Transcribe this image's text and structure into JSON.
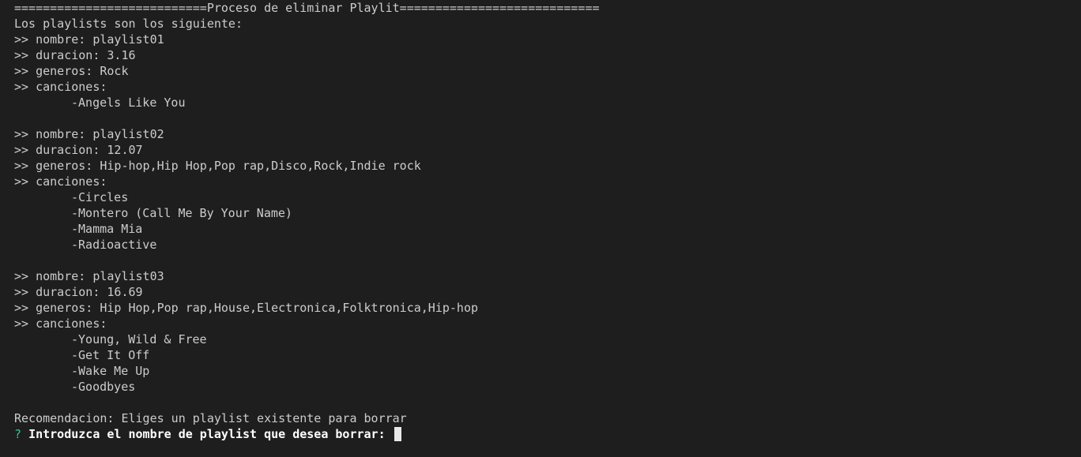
{
  "header": "===========================Proceso de eliminar Playlit============================",
  "intro": "Los playlists son los siguiente:",
  "playlists": [
    {
      "nombre": ">> nombre: playlist01",
      "duracion": ">> duracion: 3.16",
      "generos": ">> generos: Rock",
      "canciones_label": ">> canciones:",
      "canciones": [
        "-Angels Like You"
      ]
    },
    {
      "nombre": ">> nombre: playlist02",
      "duracion": ">> duracion: 12.07",
      "generos": ">> generos: Hip-hop,Hip Hop,Pop rap,Disco,Rock,Indie rock",
      "canciones_label": ">> canciones:",
      "canciones": [
        "-Circles",
        "-Montero (Call Me By Your Name)",
        "-Mamma Mia",
        "-Radioactive"
      ]
    },
    {
      "nombre": ">> nombre: playlist03",
      "duracion": ">> duracion: 16.69",
      "generos": ">> generos: Hip Hop,Pop rap,House,Electronica,Folktronica,Hip-hop",
      "canciones_label": ">> canciones:",
      "canciones": [
        "-Young, Wild & Free",
        "-Get It Off",
        "-Wake Me Up",
        "-Goodbyes"
      ]
    }
  ],
  "recommendation": "Recomendacion: Eliges un playlist existente para borrar",
  "prompt": {
    "mark": "?",
    "question": "Introduzca el nombre de playlist que desea borrar:",
    "input_value": ""
  },
  "colors": {
    "background": "#1e1e1e",
    "text": "#cccccc",
    "prompt_mark": "#23d18b",
    "prompt_text": "#ffffff"
  }
}
